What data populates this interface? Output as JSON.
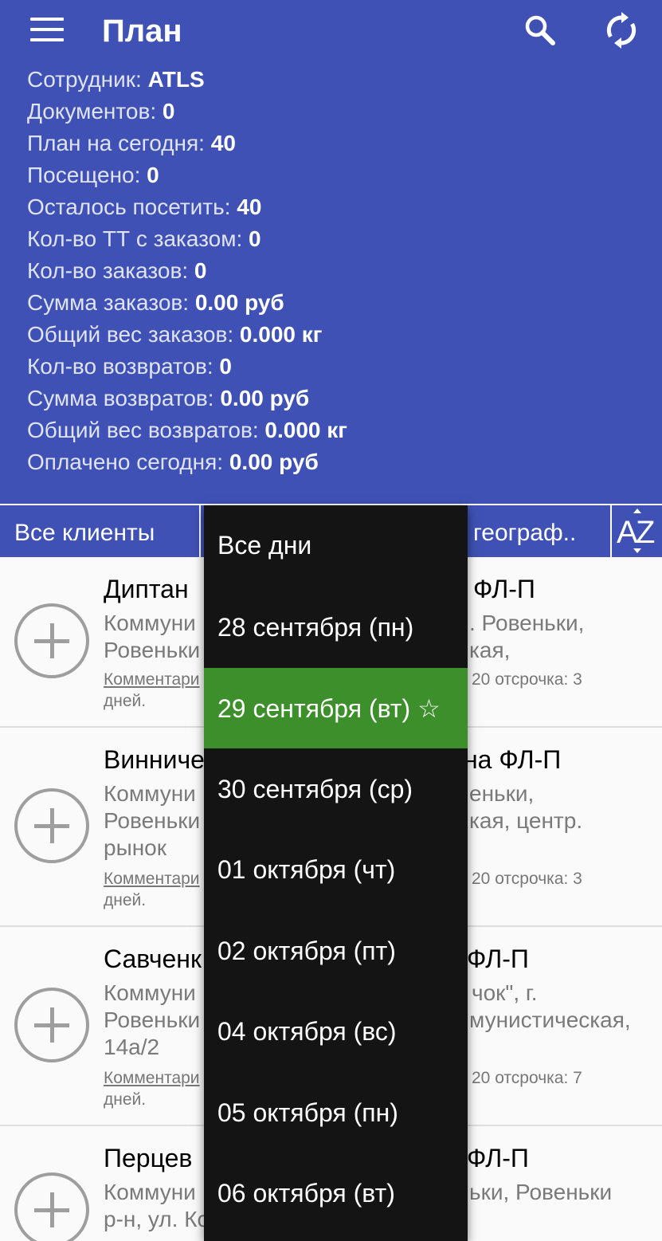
{
  "header": {
    "title": "План",
    "menu_icon": "hamburger-menu-icon",
    "search_icon": "search-icon",
    "sync_icon": "sync-icon",
    "background_color": "#3f51b5"
  },
  "stats": [
    {
      "label": "Сотрудник: ",
      "value": "ATLS"
    },
    {
      "label": "Документов: ",
      "value": "0"
    },
    {
      "label": "План на сегодня: ",
      "value": "40"
    },
    {
      "label": "Посещено: ",
      "value": "0"
    },
    {
      "label": "Осталось посетить: ",
      "value": "40"
    },
    {
      "label": "Кол-во ТТ с заказом: ",
      "value": "0"
    },
    {
      "label": "Кол-во заказов: ",
      "value": "0"
    },
    {
      "label": "Сумма заказов: ",
      "value": "0.00 руб"
    },
    {
      "label": "Общий вес заказов: ",
      "value": "0.000 кг"
    },
    {
      "label": "Кол-во возвратов: ",
      "value": "0"
    },
    {
      "label": "Сумма возвратов: ",
      "value": "0.00 руб"
    },
    {
      "label": "Общий вес возвратов: ",
      "value": "0.000 кг"
    },
    {
      "label": "Оплачено сегодня: ",
      "value": "0.00 руб"
    }
  ],
  "filters": {
    "clients": "Все клиенты",
    "geography": "географ..",
    "sort_icon": "sort-az-icon",
    "sort_label_a": "A",
    "sort_label_z": "Z"
  },
  "clients": [
    {
      "name_left": "Диптан",
      "name_right": "ФЛ-П",
      "addr_left_1": "Коммуни",
      "addr_left_2": "Ровеньки",
      "addr_right_1": ". Ровеньки,",
      "addr_right_2": "кая,",
      "addr_left_3": "",
      "comment_left": "Комментари",
      "comment_right": "20 отсрочка: 3",
      "comment_line2": "дней."
    },
    {
      "name_left": "Винниче",
      "name_right": "на ФЛ-П",
      "addr_left_1": "Коммуни",
      "addr_left_2": "Ровеньки",
      "addr_right_1": "еньки,",
      "addr_right_2": "кая, центр.",
      "addr_left_3": "рынок",
      "comment_left": "Комментари",
      "comment_right": "20 отсрочка: 3",
      "comment_line2": "дней."
    },
    {
      "name_left": "Савченк",
      "name_right": "ФЛ-П",
      "addr_left_1": "Коммуни",
      "addr_left_2": "Ровеньки",
      "addr_right_1": "чок\", г.",
      "addr_right_2": "мунистическая,",
      "addr_left_3": "14а/2",
      "comment_left": "Комментари",
      "comment_right": "20 отсрочка: 7",
      "comment_line2": "дней."
    },
    {
      "name_left": "Перцев",
      "name_right": "ФЛ-П",
      "addr_left_1": "Коммуни",
      "addr_left_2": "р-н, ул. Ко",
      "addr_right_1": "ьки, Ровеньки",
      "addr_right_2": "",
      "addr_left_3": "",
      "comment_left": "",
      "comment_right": "",
      "comment_line2": ""
    }
  ],
  "dropdown": {
    "selected_color": "#3d8f2c",
    "items": [
      {
        "label": "Все дни"
      },
      {
        "label": "28 сентября (пн)"
      },
      {
        "label": "29 сентября (вт) ☆"
      },
      {
        "label": "30 сентября (ср)"
      },
      {
        "label": "01 октября (чт)"
      },
      {
        "label": "02 октября (пт)"
      },
      {
        "label": "04 октября (вс)"
      },
      {
        "label": "05 октября (пн)"
      },
      {
        "label": "06 октября (вт)"
      }
    ]
  }
}
